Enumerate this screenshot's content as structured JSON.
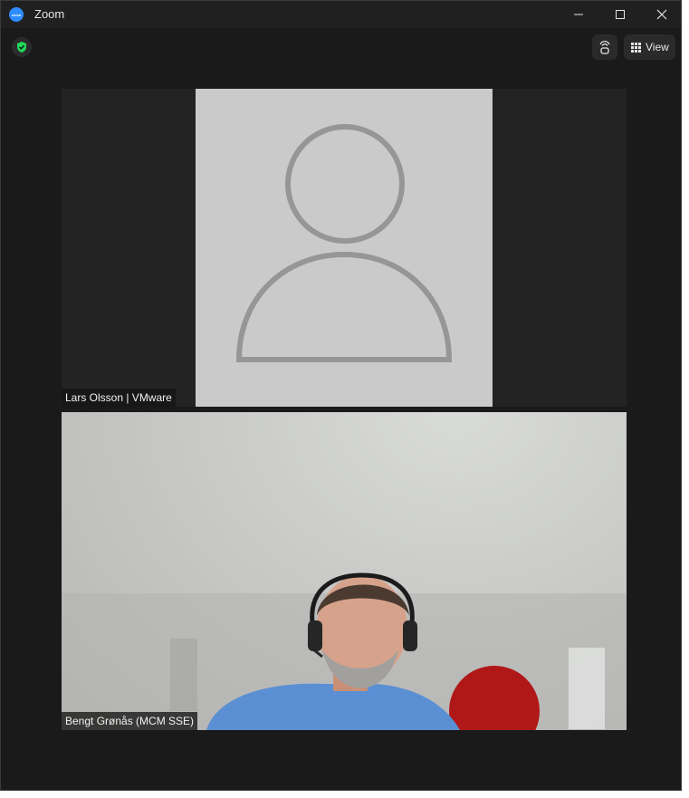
{
  "window": {
    "title": "Zoom",
    "app_logo_text": "zoom"
  },
  "toolbar": {
    "view_label": "View"
  },
  "participants": [
    {
      "name": "Lars Olsson | VMware"
    },
    {
      "name": "Bengt Grønås (MCM SSE)"
    }
  ],
  "colors": {
    "background": "#1a1a1a",
    "accent": "#2d8cff",
    "secure": "#23d959",
    "avatar_bg": "#cacaca"
  }
}
